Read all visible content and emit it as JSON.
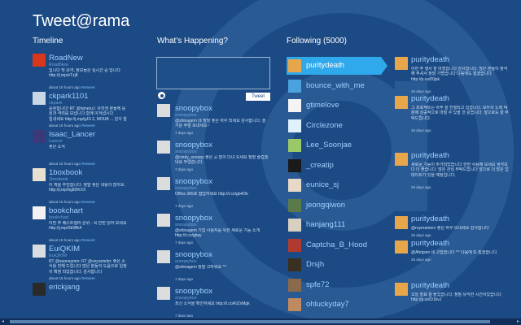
{
  "app": {
    "title": "Tweet@rama"
  },
  "columns": {
    "timeline": "Timeline",
    "whats_happening": "What's Happening?",
    "following": "Following (5000)"
  },
  "compose": {
    "tweet_label": "Tweet"
  },
  "timeline": [
    {
      "user": "RoadNew",
      "sub": "RoadNew",
      "text": "입니다 및 요약, 정보들은 실시간 중 입니다\n http://j.mp/eTzj8",
      "meta": "about 15 hours ago",
      "rt": "Retweet",
      "color": "#d9371c"
    },
    {
      "user": "ckpark1101",
      "sub": "ckpark",
      "text": "응원합니다! RT @hjmetu1: 유학생 분들께 응원과 격려를 보냅니다 함께 이겨냅시다\n 힘내세요 http://j.mp/gJS 2, MOUB ... 감사 합니다 http://t.co/gu83Gq4d",
      "meta": "about 15 hours ago",
      "rt": "Retweet",
      "color": "#c8d6e6"
    },
    {
      "user": "Isaac_Lancer",
      "sub": "Lancer",
      "text": "좋은 소식",
      "meta": "about 15 hours ago",
      "rt": "Retweet",
      "color": "#3a3a7a"
    },
    {
      "user": "1boxbook",
      "sub": "1boxbook",
      "text": "이 책을 추천합니다. 정말 좋은 내용이 많아요.\n http://j.mp/hg8DKXX",
      "meta": "about 15 hours ago",
      "rt": "Retweet",
      "color": "#e8e0d0"
    },
    {
      "user": "bookchart",
      "sub": "bookchart",
      "text": "이번 주 베스트셀러 순위 - 꼭 한번 읽어 보세요\n http://j.mp/Sk9Bk4",
      "meta": "about 15 hours ago",
      "rt": "Retweet",
      "color": "#f2f2f2"
    },
    {
      "user": "EuiQKIM",
      "sub": "EuiQKIM",
      "text": "RT @soonsamm: RT @vncamelm: 좋은 소식을 전해 드립니다 많은 분들의 도움으로 일정이 확정 되었습니다. 감사합니다 http://dlvr.it/bQWE",
      "meta": "about 15 hours ago",
      "rt": "Retweet",
      "color": "#d8dde2"
    },
    {
      "user": "erickjang",
      "sub": "",
      "text": "",
      "meta": "",
      "rt": "",
      "color": "#2a2a2a"
    }
  ],
  "happening": [
    {
      "user": "snoopybox",
      "sub": "snoopybox",
      "text": "@shinagem 네 정말 좋은 하루 되세요 감사합니다. 즐거운 주말 보내세요~",
      "meta": "7 days ago"
    },
    {
      "user": "snoopybox",
      "sub": "snoopybox",
      "text": "@cindy_snoopy 좋은 곳 많이 다녀 오세요 정말 즐겁겠네요 부럽습니다.",
      "meta": "7 days ago"
    },
    {
      "user": "snoopybox",
      "sub": "snoopybox",
      "text": "Office 365로 협업하세요 http://t.co/gb4Ok",
      "meta": "7 days ago"
    },
    {
      "user": "snoopybox",
      "sub": "snoopybox",
      "text": "@shinagem 기업 사용자를 위한 새로운 기능 소개 http://t.co/gbsy",
      "meta": "7 days ago"
    },
    {
      "user": "snoopybox",
      "sub": "snoopybox",
      "text": "@shinagem 정말 고마워요 ^^",
      "meta": "7 days ago"
    },
    {
      "user": "snoopybox",
      "sub": "snoopybox",
      "text": "최신 소식을 확인하세요 http://t.co/KlZxMgk",
      "meta": "7 days ago"
    }
  ],
  "following": [
    {
      "name": "puritydeath",
      "color": "#e8a64a",
      "selected": true
    },
    {
      "name": "bounce_with_me",
      "color": "#4aa3df",
      "selected": false
    },
    {
      "name": "gtimelove",
      "color": "#f4f4f4",
      "selected": false
    },
    {
      "name": "Circlezone",
      "color": "#dff1fb",
      "selected": false
    },
    {
      "name": "Lee_Soonjae",
      "color": "#9bc96a",
      "selected": false
    },
    {
      "name": "_creatip",
      "color": "#1a1a1a",
      "selected": false
    },
    {
      "name": "eunice_sj",
      "color": "#e8d8c8",
      "selected": false
    },
    {
      "name": "jeongqiwon",
      "color": "#5a7a4a",
      "selected": false
    },
    {
      "name": "hanjang111",
      "color": "#d8d0c0",
      "selected": false
    },
    {
      "name": "Captcha_B_Hood",
      "color": "#b03a30",
      "selected": false
    },
    {
      "name": "Drsjh",
      "color": "#3a3020",
      "selected": false
    },
    {
      "name": "spfe72",
      "color": "#8a6a4a",
      "selected": false
    },
    {
      "name": "ohluckyday7",
      "color": "#c08a60",
      "selected": false
    }
  ],
  "detail": [
    {
      "user": "puritydeath",
      "text": "이번 주 행사 잘 마쳤습니다 감사합니다. 많은 분들이 참석해 주셔서 정말 기뻤습니다 다음에도 뵙겠습니다 http://p.us/00jsk",
      "meta": "26 days ago"
    },
    {
      "user": "puritydeath",
      "text": "그 프로젝트는 아주 잘 진행되고 있습니다. 모두의 노력 덕분에 성공적으로 마칠 수 있을 것 같습니다. 앞으로도 잘 부탁드립니다.",
      "meta": "26 days ago"
    },
    {
      "user": "puritydeath",
      "text": "새로운 기능이 추가되었습니다 한번 사용해 보세요 생각보다 더 좋습니다. 많은 관심 부탁드립니다 앞으로 더 많은 업데이트가 있을 예정입니다.",
      "meta": "26 days ago"
    },
    {
      "user": "puritydeath",
      "text": "@royeramerc 좋은 하루 보내세요 감사합니다",
      "meta": "26 days ago"
    },
    {
      "user": "puritydeath",
      "text": "@Ahnjsen 네 고맙습니다 ^^ 다음에 또 뵙겠습니다",
      "meta": "26 days ago"
    },
    {
      "user": "puritydeath",
      "text": "오늘 발표 잘 들었습니다. 정말 유익한 시간이었습니다 http://p.us/D1kvJ",
      "meta": ""
    }
  ]
}
